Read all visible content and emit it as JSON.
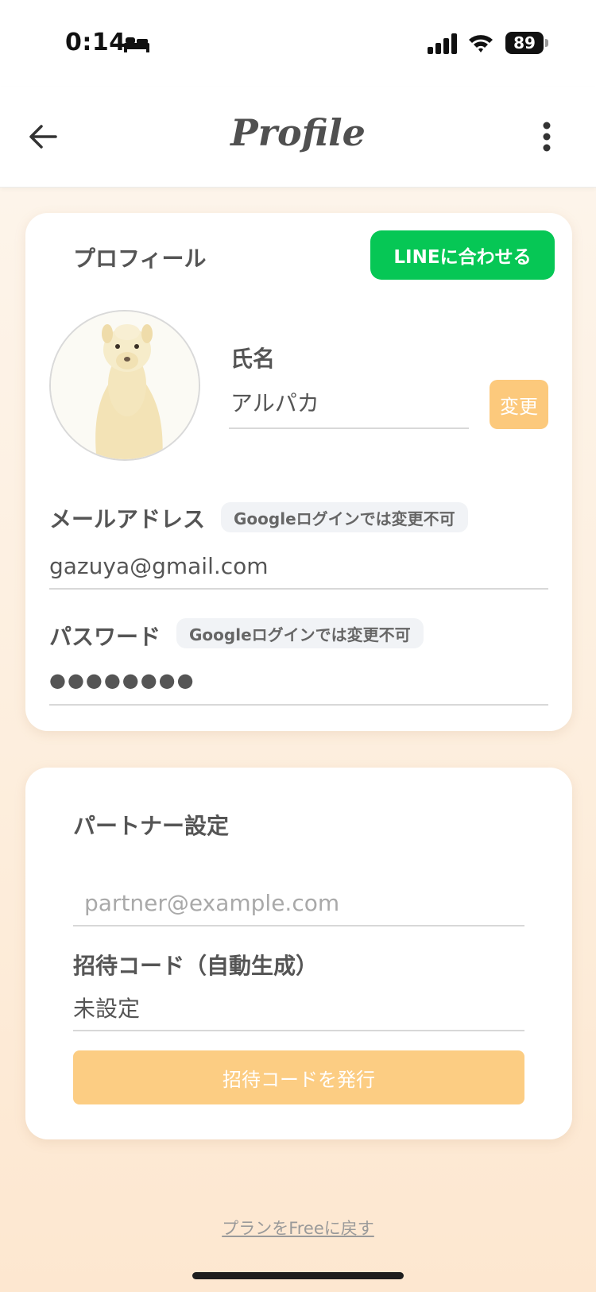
{
  "status_bar": {
    "time": "0:14",
    "battery": "89"
  },
  "header": {
    "title": "Profile",
    "back_icon": "arrow-left-icon",
    "more_icon": "kebab-menu-icon"
  },
  "profile": {
    "section_title": "プロフィール",
    "line_button": "LINEに合わせる",
    "avatar": "alpaca-avatar",
    "name_label": "氏名",
    "name_value": "アルパカ",
    "change_button": "変更",
    "email_label": "メールアドレス",
    "email_note": "Googleログインでは変更不可",
    "email_value": "gazuya@gmail.com",
    "password_label": "パスワード",
    "password_note": "Googleログインでは変更不可",
    "password_value": "●●●●●●●●"
  },
  "partner": {
    "section_title": "パートナー設定",
    "email_placeholder": "partner@example.com",
    "invite_label": "招待コード（自動生成）",
    "invite_value": "未設定",
    "issue_button": "招待コードを発行"
  },
  "footer": {
    "reset_plan_link": "プランをFreeに戻す"
  },
  "colors": {
    "line_green": "#06c755",
    "accent_orange": "#fcc97c",
    "text": "#4a4a4a"
  }
}
